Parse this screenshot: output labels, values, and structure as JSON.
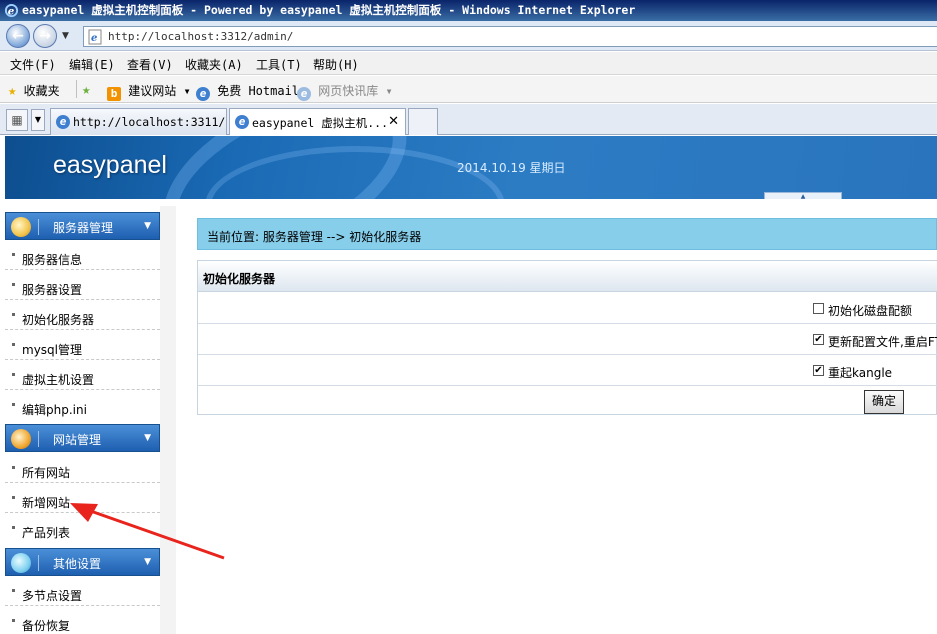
{
  "window": {
    "title": "easypanel 虚拟主机控制面板 - Powered by easypanel 虚拟主机控制面板 - Windows Internet Explorer"
  },
  "address": {
    "url": "http://localhost:3312/admin/"
  },
  "menubar": {
    "items": [
      "文件(F)",
      "编辑(E)",
      "查看(V)",
      "收藏夹(A)",
      "工具(T)",
      "帮助(H)"
    ]
  },
  "favorites": {
    "favorites_label": "收藏夹",
    "items": [
      "建议网站 ▾",
      "免费 Hotmail",
      "网页快讯库 ▾"
    ]
  },
  "tabs": [
    {
      "label": "http://localhost:3311/",
      "active": false
    },
    {
      "label": "easypanel 虚拟主机...",
      "active": true
    }
  ],
  "header": {
    "logo": "easypanel",
    "date": "2014.10.19 星期日"
  },
  "sidebar": {
    "sections": [
      {
        "label": "服务器管理",
        "items": [
          "服务器信息",
          "服务器设置",
          "初始化服务器",
          "mysql管理",
          "虚拟主机设置",
          "编辑php.ini"
        ]
      },
      {
        "label": "网站管理",
        "items": [
          "所有网站",
          "新增网站",
          "产品列表"
        ]
      },
      {
        "label": "其他设置",
        "items": [
          "多节点设置",
          "备份恢复"
        ]
      }
    ]
  },
  "main": {
    "breadcrumb": "当前位置: 服务器管理 --> 初始化服务器",
    "panel_title": "初始化服务器",
    "options": [
      {
        "label": "初始化磁盘配额",
        "checked": false
      },
      {
        "label": "更新配置文件,重启FTP",
        "checked": true
      },
      {
        "label": "重起kangle",
        "checked": true
      }
    ],
    "submit_label": "确定"
  },
  "colors": {
    "accent": "#1e5fb0",
    "breadcrumb_bg": "#87ceeb",
    "annotation": "#e8241c"
  }
}
